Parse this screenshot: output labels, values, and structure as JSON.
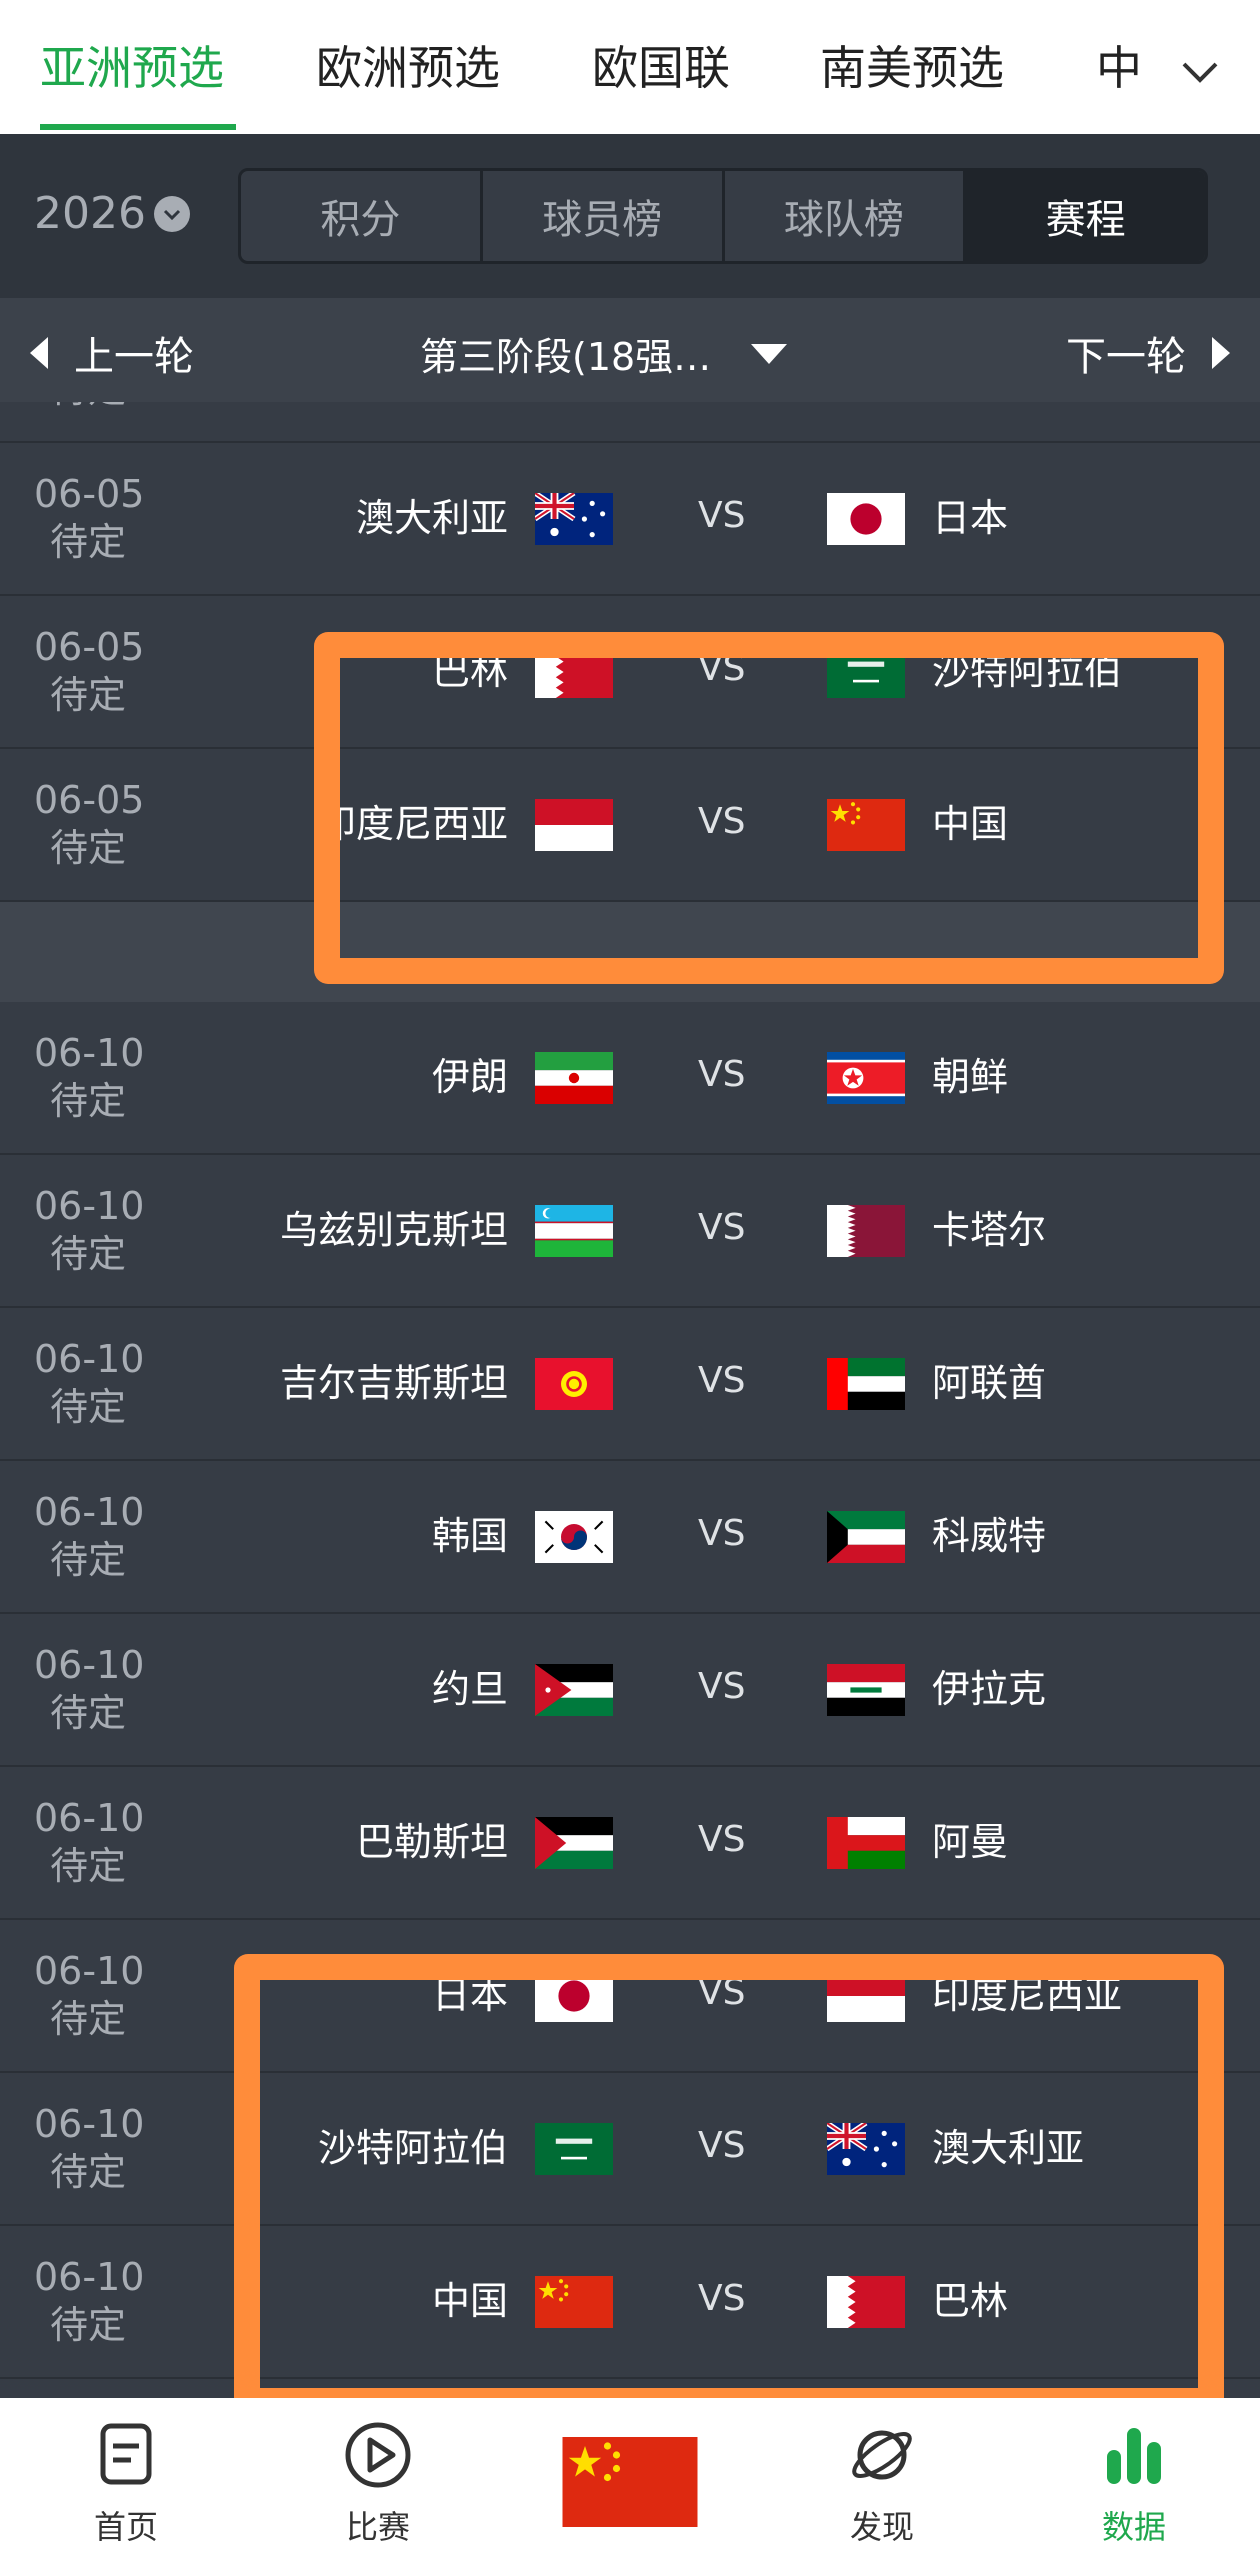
{
  "top_tabs": [
    "亚洲预选",
    "欧洲预选",
    "欧国联",
    "南美预选",
    "中"
  ],
  "filter": {
    "year": "2026",
    "segments": [
      "积分",
      "球员榜",
      "球队榜",
      "赛程"
    ],
    "active_segment": "赛程"
  },
  "round": {
    "prev": "上一轮",
    "stage": "第三阶段(18强…",
    "next": "下一轮"
  },
  "matches": [
    {
      "date": "06-05",
      "status": "待定",
      "home": "澳大利亚",
      "home_flag": "australia-flag",
      "vs": "VS",
      "away": "日本",
      "away_flag": "japan-flag"
    },
    {
      "date": "06-05",
      "status": "待定",
      "home": "巴林",
      "home_flag": "bahrain-flag",
      "vs": "VS",
      "away": "沙特阿拉伯",
      "away_flag": "saudi-flag"
    },
    {
      "date": "06-05",
      "status": "待定",
      "home": "印度尼西亚",
      "home_flag": "indonesia-flag",
      "vs": "VS",
      "away": "中国",
      "away_flag": "china-flag"
    },
    {
      "date": "06-10",
      "status": "待定",
      "home": "伊朗",
      "home_flag": "iran-flag",
      "vs": "VS",
      "away": "朝鲜",
      "away_flag": "north-korea-flag"
    },
    {
      "date": "06-10",
      "status": "待定",
      "home": "乌兹别克斯坦",
      "home_flag": "uzbekistan-flag",
      "vs": "VS",
      "away": "卡塔尔",
      "away_flag": "qatar-flag"
    },
    {
      "date": "06-10",
      "status": "待定",
      "home": "吉尔吉斯斯坦",
      "home_flag": "kyrgyzstan-flag",
      "vs": "VS",
      "away": "阿联酋",
      "away_flag": "uae-flag"
    },
    {
      "date": "06-10",
      "status": "待定",
      "home": "韩国",
      "home_flag": "south-korea-flag",
      "vs": "VS",
      "away": "科威特",
      "away_flag": "kuwait-flag"
    },
    {
      "date": "06-10",
      "status": "待定",
      "home": "约旦",
      "home_flag": "jordan-flag",
      "vs": "VS",
      "away": "伊拉克",
      "away_flag": "iraq-flag"
    },
    {
      "date": "06-10",
      "status": "待定",
      "home": "巴勒斯坦",
      "home_flag": "palestine-flag",
      "vs": "VS",
      "away": "阿曼",
      "away_flag": "oman-flag"
    },
    {
      "date": "06-10",
      "status": "待定",
      "home": "日本",
      "home_flag": "japan-flag",
      "vs": "VS",
      "away": "印度尼西亚",
      "away_flag": "indonesia-flag"
    },
    {
      "date": "06-10",
      "status": "待定",
      "home": "沙特阿拉伯",
      "home_flag": "saudi-flag",
      "vs": "VS",
      "away": "澳大利亚",
      "away_flag": "australia-flag"
    },
    {
      "date": "06-10",
      "status": "待定",
      "home": "中国",
      "home_flag": "china-flag",
      "vs": "VS",
      "away": "巴林",
      "away_flag": "bahrain-flag"
    }
  ],
  "partial_top_status": "待定",
  "bottom_nav": [
    "首页",
    "比赛",
    "发现",
    "数据"
  ],
  "colors": {
    "accent": "#1fa84d",
    "highlight": "#ff8c3a",
    "background": "#363c45"
  }
}
